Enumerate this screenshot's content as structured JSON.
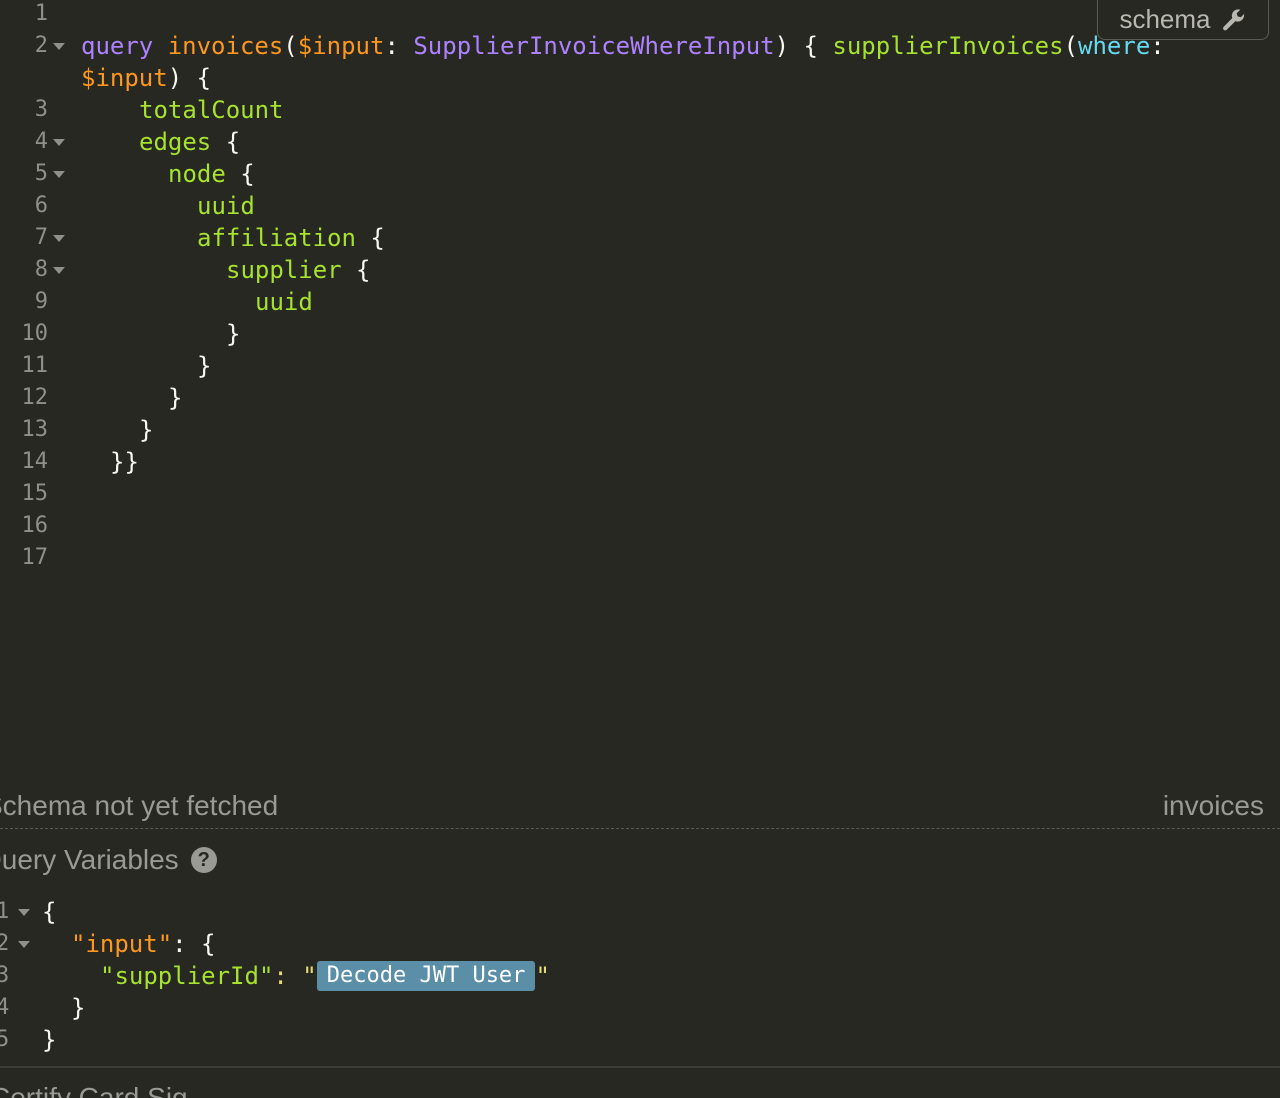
{
  "query_editor": {
    "line_numbers": [
      "1",
      "2",
      "3",
      "4",
      "5",
      "6",
      "7",
      "8",
      "9",
      "10",
      "11",
      "12",
      "13",
      "14",
      "15",
      "16",
      "17"
    ],
    "line2": {
      "keyword": "query",
      "op_name": "invoices",
      "open_paren": "(",
      "var_name": "$input",
      "colon": ": ",
      "type_name": "SupplierInvoiceWhereInput",
      "close_brace_open": ") { ",
      "field": "supplierInvoices",
      "arg_open": "(",
      "arg_name": "where",
      "arg_colon": ":"
    },
    "line2_wrap": {
      "var_name": "$input",
      "rest": ") {"
    },
    "fields": {
      "totalCount": "totalCount",
      "edges": "edges",
      "node": "node",
      "uuid1": "uuid",
      "affiliation": "affiliation",
      "supplier": "supplier",
      "uuid2": "uuid"
    },
    "brace_open": " {",
    "brace_close": "}",
    "brace_close_double": "}}"
  },
  "schema_button": {
    "label": "schema",
    "icon": "wrench-icon"
  },
  "status_bar": {
    "left_text": "Schema not yet fetched",
    "right_text": "invoices"
  },
  "variables_panel": {
    "title": "Query Variables",
    "help_icon": "?",
    "line_numbers": [
      "1",
      "2",
      "3",
      "4",
      "5"
    ],
    "open_brace": "{",
    "input_key": "\"input\"",
    "colon_brace": ": {",
    "supplier_key": "\"supplierId\"",
    "colon_quote": ": \"",
    "chip_label": "Decode JWT User",
    "close_quote": "\"",
    "inner_close": "}",
    "outer_close": "}"
  },
  "bottom_tab": {
    "label": "Certify Card Sig..."
  },
  "colors": {
    "background": "#272822",
    "keyword": "#ae81ff",
    "field": "#a6e22e",
    "variable": "#fd971f",
    "argument": "#66d9ef",
    "string": "#e6db74",
    "chip": "#5b8fa8"
  }
}
